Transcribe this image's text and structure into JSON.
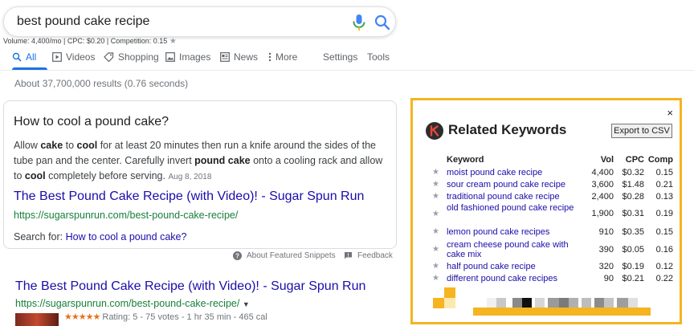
{
  "search": {
    "query": "best pound cake recipe"
  },
  "volume_line": "Volume: 4,400/mo | CPC: $0.20 | Competition: 0.15",
  "tabs": [
    {
      "label": "All",
      "icon": "search-icon",
      "active": true
    },
    {
      "label": "Videos",
      "icon": "play-icon"
    },
    {
      "label": "Shopping",
      "icon": "tag-icon"
    },
    {
      "label": "Images",
      "icon": "image-icon"
    },
    {
      "label": "News",
      "icon": "news-icon"
    },
    {
      "label": "More",
      "icon": "more-dots-icon"
    },
    {
      "label": "Settings"
    },
    {
      "label": "Tools"
    }
  ],
  "stats": "About 37,700,000 results (0.76 seconds)",
  "snippet": {
    "heading": "How to cool a pound cake?",
    "body_parts": [
      {
        "t": "Allow ",
        "b": false
      },
      {
        "t": "cake",
        "b": true
      },
      {
        "t": " to ",
        "b": false
      },
      {
        "t": "cool",
        "b": true
      },
      {
        "t": " for at least 20 minutes then run a knife around the sides of the tube pan and the center. Carefully invert ",
        "b": false
      },
      {
        "t": "pound cake",
        "b": true
      },
      {
        "t": " onto a cooling rack and allow to ",
        "b": false
      },
      {
        "t": "cool",
        "b": true
      },
      {
        "t": " completely before serving.",
        "b": false
      }
    ],
    "date": "Aug 8, 2018",
    "link": "The Best Pound Cake Recipe (with Video)! - Sugar Spun Run",
    "url": "https://sugarspunrun.com/best-pound-cake-recipe/",
    "search_for_label": "Search for:",
    "search_for_link": "How to cool a pound cake?"
  },
  "about_snippets": "About Featured Snippets",
  "feedback": "Feedback",
  "result2": {
    "link": "The Best Pound Cake Recipe (with Video)! - Sugar Spun Run",
    "url": "https://sugarspunrun.com/best-pound-cake-recipe/",
    "stars": "★★★★★",
    "rating": "Rating: 5 - 75 votes - 1 hr 35 min - 465 cal"
  },
  "panel": {
    "close": "×",
    "logo_letter": "K",
    "title": "Related Keywords",
    "export_label": "Export to CSV",
    "headers": {
      "keyword": "Keyword",
      "vol": "Vol",
      "cpc": "CPC",
      "comp": "Comp"
    },
    "rows": [
      {
        "keyword": "moist pound cake recipe",
        "vol": "4,400",
        "cpc": "$0.32",
        "comp": "0.15"
      },
      {
        "keyword": "sour cream pound cake recipe",
        "vol": "3,600",
        "cpc": "$1.48",
        "comp": "0.21"
      },
      {
        "keyword": "traditional pound cake recipe",
        "vol": "2,400",
        "cpc": "$0.28",
        "comp": "0.13"
      },
      {
        "keyword": "old fashioned pound cake recipe",
        "vol": "1,900",
        "cpc": "$0.31",
        "comp": "0.19",
        "tall": true
      },
      {
        "keyword": "lemon pound cake recipes",
        "vol": "910",
        "cpc": "$0.35",
        "comp": "0.15"
      },
      {
        "keyword": "cream cheese pound cake with cake mix",
        "vol": "390",
        "cpc": "$0.05",
        "comp": "0.16",
        "tall": true
      },
      {
        "keyword": "half pound cake recipe",
        "vol": "320",
        "cpc": "$0.19",
        "comp": "0.12"
      },
      {
        "keyword": "different pound cake recipes",
        "vol": "90",
        "cpc": "$0.21",
        "comp": "0.22"
      }
    ]
  },
  "colors": {
    "accent": "#1a73e8",
    "link": "#1a0dab",
    "url_green": "#188038",
    "panel_border": "#f5b420",
    "bar_yellow": "#f5b420"
  }
}
